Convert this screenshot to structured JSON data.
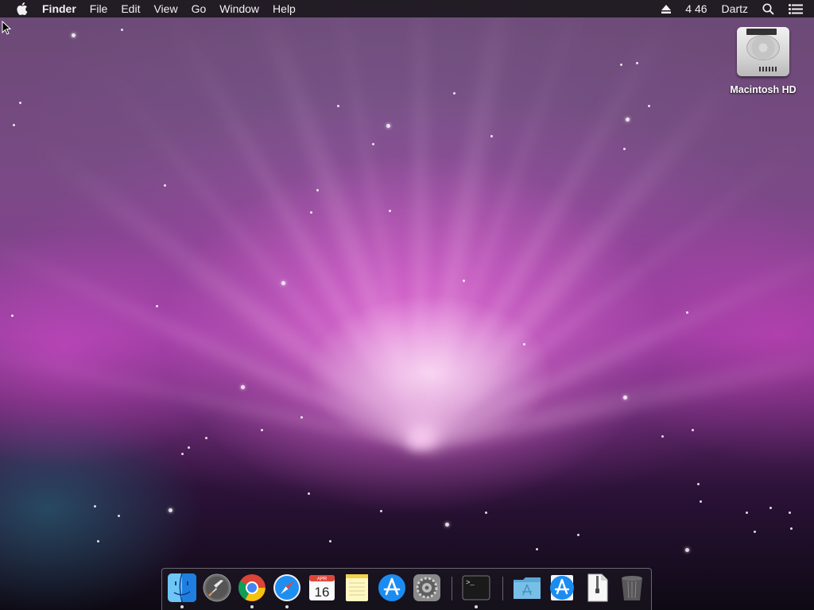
{
  "menubar": {
    "apple_icon": "apple-logo-icon",
    "app_name": "Finder",
    "items": [
      {
        "label": "File"
      },
      {
        "label": "Edit"
      },
      {
        "label": "View"
      },
      {
        "label": "Go"
      },
      {
        "label": "Window"
      },
      {
        "label": "Help"
      }
    ],
    "right": {
      "eject_icon": "eject-icon",
      "clock": "4 46",
      "user": "Dartz",
      "search_icon": "spotlight-search-icon",
      "notification_icon": "notification-center-icon"
    }
  },
  "desktop": {
    "icons": [
      {
        "label": "Macintosh HD",
        "icon": "hard-drive-icon"
      }
    ]
  },
  "dock": {
    "items": [
      {
        "name": "Finder",
        "icon": "finder-icon",
        "running": true
      },
      {
        "name": "Launchpad",
        "icon": "launchpad-rocket-icon",
        "running": false
      },
      {
        "name": "Google Chrome",
        "icon": "chrome-icon",
        "running": true
      },
      {
        "name": "Safari",
        "icon": "safari-compass-icon",
        "running": true
      },
      {
        "name": "Calendar",
        "icon": "calendar-icon",
        "month": "APR",
        "day": "16",
        "running": false
      },
      {
        "name": "Notes",
        "icon": "notes-icon",
        "running": false
      },
      {
        "name": "App Store",
        "icon": "app-store-icon",
        "running": false
      },
      {
        "name": "System Preferences",
        "icon": "gear-icon",
        "running": false
      },
      {
        "name": "Terminal",
        "icon": "terminal-icon",
        "prompt": ">_",
        "running": true
      },
      {
        "name": "Applications",
        "icon": "folder-icon",
        "running": false
      },
      {
        "name": "Downloads",
        "icon": "app-store-download-icon",
        "running": false
      },
      {
        "name": "Archive",
        "icon": "zip-file-icon",
        "running": false
      },
      {
        "name": "Trash",
        "icon": "trash-icon",
        "running": false
      }
    ]
  },
  "colors": {
    "menubar_bg": "#1c181e",
    "wallpaper_accent": "#e070d8"
  }
}
